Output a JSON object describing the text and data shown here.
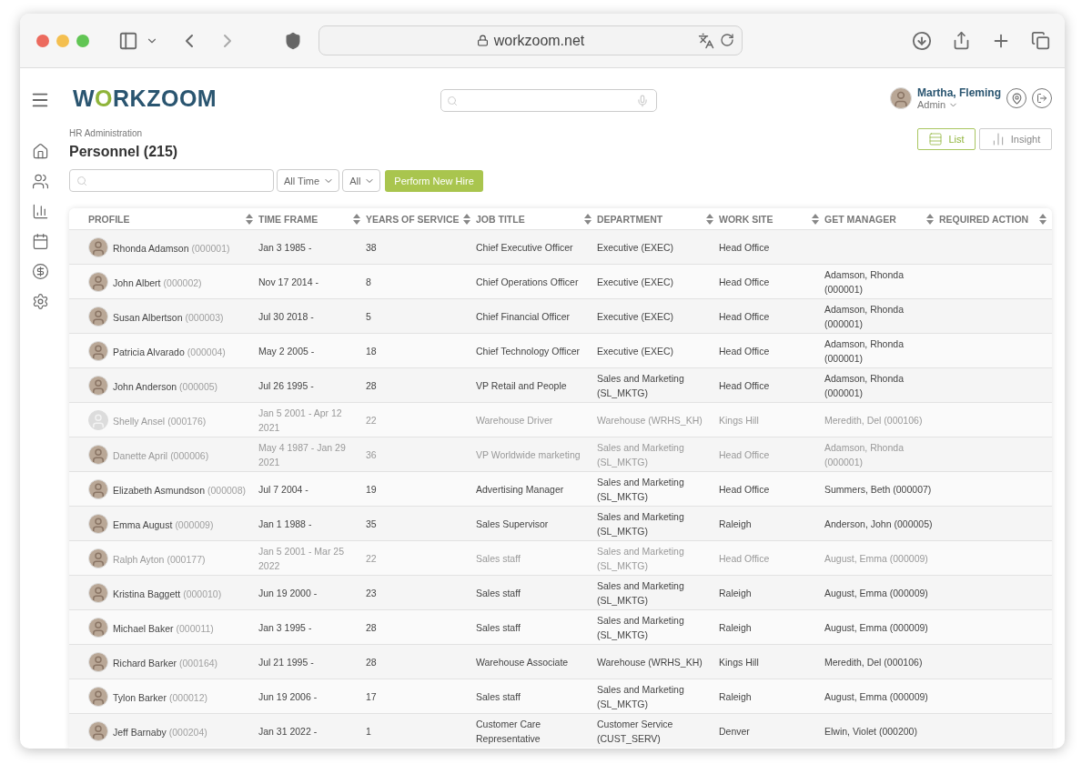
{
  "browser": {
    "url": "workzoom.net"
  },
  "app": {
    "logo": "WORKZOOM",
    "user": {
      "name": "Martha, Fleming",
      "role": "Admin"
    }
  },
  "sidebar": {
    "items": [
      {
        "kind": "home",
        "selected": false
      },
      {
        "kind": "people",
        "selected": false
      },
      {
        "kind": "chart",
        "selected": false
      },
      {
        "kind": "calendar",
        "selected": false
      },
      {
        "kind": "dollar",
        "selected": false
      },
      {
        "kind": "settings",
        "selected": false
      }
    ]
  },
  "page": {
    "breadcrumb": "HR Administration",
    "title": "Personnel (215)"
  },
  "views": [
    {
      "label": "List",
      "kind": "list",
      "selected": true
    },
    {
      "label": "Insight",
      "kind": "insight",
      "selected": false
    }
  ],
  "filters": {
    "selects": [
      "All Time",
      "All"
    ],
    "action": "Perform New Hire"
  },
  "table": {
    "columns": [
      {
        "label": "PROFILE",
        "sortable": true
      },
      {
        "label": "TIME FRAME",
        "sortable": true
      },
      {
        "label": "YEARS OF SERVICE",
        "sortable": true
      },
      {
        "label": "JOB TITLE",
        "sortable": true
      },
      {
        "label": "DEPARTMENT",
        "sortable": true
      },
      {
        "label": "WORK SITE",
        "sortable": true
      },
      {
        "label": "GET MANAGER",
        "sortable": true
      },
      {
        "label": "REQUIRED ACTION",
        "sortable": true
      }
    ],
    "rows": [
      {
        "name": "Rhonda Adamson",
        "id": "(000001)",
        "has_photo": true,
        "inactive": false,
        "time_frame": "Jan 3 1985 -",
        "years": "38",
        "job_title": "Chief Executive Officer",
        "department": "Executive (EXEC)",
        "work_site": "Head Office"
      },
      {
        "name": "John Albert",
        "id": "(000002)",
        "has_photo": true,
        "inactive": false,
        "time_frame": "Nov 17 2014 -",
        "years": "8",
        "job_title": "Chief Operations Officer",
        "department": "Executive (EXEC)",
        "work_site": "Head Office",
        "manager": "Adamson, Rhonda (000001)"
      },
      {
        "name": "Susan Albertson",
        "id": "(000003)",
        "has_photo": true,
        "inactive": false,
        "time_frame": "Jul 30 2018 -",
        "years": "5",
        "job_title": "Chief Financial Officer",
        "department": "Executive (EXEC)",
        "work_site": "Head Office",
        "manager": "Adamson, Rhonda (000001)"
      },
      {
        "name": "Patricia Alvarado",
        "id": "(000004)",
        "has_photo": true,
        "inactive": false,
        "time_frame": "May 2 2005 -",
        "years": "18",
        "job_title": "Chief Technology Officer",
        "department": "Executive (EXEC)",
        "work_site": "Head Office",
        "manager": "Adamson, Rhonda (000001)"
      },
      {
        "name": "John Anderson",
        "id": "(000005)",
        "has_photo": true,
        "inactive": false,
        "time_frame": "Jul 26 1995 -",
        "years": "28",
        "job_title": "VP Retail and People",
        "department": "Sales and Marketing (SL_MKTG)",
        "work_site": "Head Office",
        "manager": "Adamson, Rhonda (000001)"
      },
      {
        "name": "Shelly Ansel",
        "id": "(000176)",
        "has_photo": false,
        "inactive": true,
        "time_frame": "Jan 5 2001 - Apr 12 2021",
        "years": "22",
        "job_title": "Warehouse Driver",
        "department": "Warehouse (WRHS_KH)",
        "work_site": "Kings Hill",
        "manager": "Meredith, Del (000106)"
      },
      {
        "name": "Danette April",
        "id": "(000006)",
        "has_photo": true,
        "inactive": true,
        "time_frame": "May 4 1987 - Jan 29 2021",
        "years": "36",
        "job_title": "VP Worldwide marketing",
        "department": "Sales and Marketing (SL_MKTG)",
        "work_site": "Head Office",
        "manager": "Adamson, Rhonda (000001)"
      },
      {
        "name": "Elizabeth Asmundson",
        "id": "(000008)",
        "has_photo": true,
        "inactive": false,
        "time_frame": "Jul 7 2004 -",
        "years": "19",
        "job_title": "Advertising Manager",
        "department": "Sales and Marketing (SL_MKTG)",
        "work_site": "Head Office",
        "manager": "Summers, Beth (000007)"
      },
      {
        "name": "Emma August",
        "id": "(000009)",
        "has_photo": true,
        "inactive": false,
        "time_frame": "Jan 1 1988 -",
        "years": "35",
        "job_title": "Sales Supervisor",
        "department": "Sales and Marketing (SL_MKTG)",
        "work_site": "Raleigh",
        "manager": "Anderson, John (000005)"
      },
      {
        "name": "Ralph Ayton",
        "id": "(000177)",
        "has_photo": true,
        "inactive": true,
        "time_frame": "Jan 5 2001 - Mar 25 2022",
        "years": "22",
        "job_title": "Sales staff",
        "department": "Sales and Marketing (SL_MKTG)",
        "work_site": "Head Office",
        "manager": "August, Emma (000009)"
      },
      {
        "name": "Kristina Baggett",
        "id": "(000010)",
        "has_photo": true,
        "inactive": false,
        "time_frame": "Jun 19 2000 -",
        "years": "23",
        "job_title": "Sales staff",
        "department": "Sales and Marketing (SL_MKTG)",
        "work_site": "Raleigh",
        "manager": "August, Emma (000009)"
      },
      {
        "name": "Michael Baker",
        "id": "(000011)",
        "has_photo": true,
        "inactive": false,
        "time_frame": "Jan 3 1995 -",
        "years": "28",
        "job_title": "Sales staff",
        "department": "Sales and Marketing (SL_MKTG)",
        "work_site": "Raleigh",
        "manager": "August, Emma (000009)"
      },
      {
        "name": "Richard Barker",
        "id": "(000164)",
        "has_photo": true,
        "inactive": false,
        "time_frame": "Jul 21 1995 -",
        "years": "28",
        "job_title": "Warehouse Associate",
        "department": "Warehouse (WRHS_KH)",
        "work_site": "Kings Hill",
        "manager": "Meredith, Del (000106)"
      },
      {
        "name": "Tylon Barker",
        "id": "(000012)",
        "has_photo": true,
        "inactive": false,
        "time_frame": "Jun 19 2006 -",
        "years": "17",
        "job_title": "Sales staff",
        "department": "Sales and Marketing (SL_MKTG)",
        "work_site": "Raleigh",
        "manager": "August, Emma (000009)"
      },
      {
        "name": "Jeff Barnaby",
        "id": "(000204)",
        "has_photo": true,
        "inactive": false,
        "time_frame": "Jan 31 2022 -",
        "years": "1",
        "job_title": "Customer Care Representative",
        "department": "Customer Service (CUST_SERV)",
        "work_site": "Denver",
        "manager": "Elwin, Violet (000200)"
      }
    ]
  }
}
